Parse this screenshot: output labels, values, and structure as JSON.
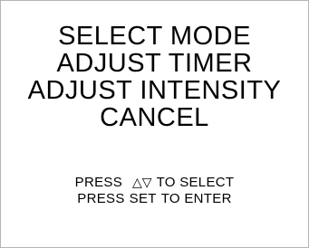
{
  "menu": {
    "items": [
      {
        "label": "SELECT MODE"
      },
      {
        "label": "ADJUST TIMER"
      },
      {
        "label": "ADJUST INTENSITY"
      },
      {
        "label": "CANCEL"
      }
    ]
  },
  "help": {
    "line1": {
      "prefix": "PRESS",
      "arrows": "△▽",
      "suffix": "TO SELECT"
    },
    "line2": {
      "prefix": "PRESS",
      "key": "SET",
      "suffix": "TO ENTER"
    }
  },
  "icons": {
    "up": "triangle-up-outline-icon",
    "down": "triangle-down-outline-icon"
  },
  "colors": {
    "background": "#ffffff",
    "text": "#000000",
    "border": "#b5b5b5"
  }
}
